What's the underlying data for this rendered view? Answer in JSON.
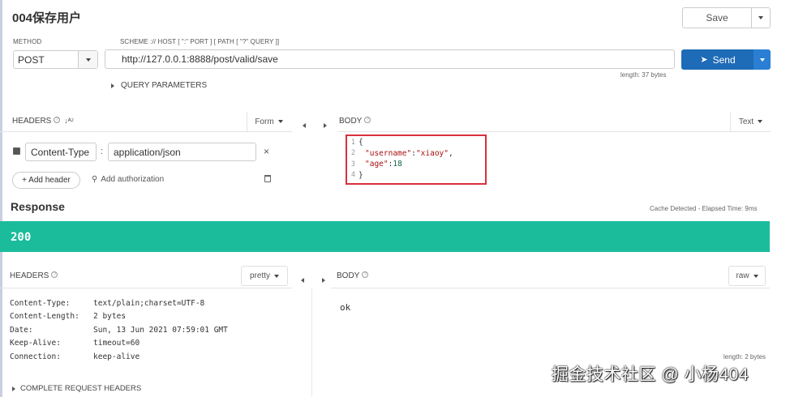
{
  "request": {
    "title": "004保存用户",
    "save_label": "Save",
    "method_label": "METHOD",
    "method": "POST",
    "url_hint": "SCHEME :// HOST [ \":\" PORT ] [ PATH [ \"?\" QUERY ]]",
    "url": "http://127.0.0.1:8888/post/valid/save",
    "send_label": "Send",
    "length": "length: 37 bytes",
    "query_params_label": "QUERY PARAMETERS"
  },
  "req_headers": {
    "label": "HEADERS",
    "mode": "Form",
    "rows": [
      {
        "name": "Content-Type",
        "value": "application/json"
      }
    ],
    "add_header": "+ Add header",
    "add_auth": "Add authorization"
  },
  "req_body": {
    "label": "BODY",
    "mode": "Text",
    "lines": [
      {
        "n": "1",
        "text": "{"
      },
      {
        "n": "2",
        "key": "\"username\"",
        "sep": ":",
        "val": "\"xiaoy\"",
        "end": ","
      },
      {
        "n": "3",
        "key": "\"age\"",
        "sep": ":",
        "num": "18",
        "end": ""
      },
      {
        "n": "4",
        "text": "}"
      }
    ]
  },
  "response": {
    "title": "Response",
    "cache_info": "Cache Detected - Elapsed Time: 9ms",
    "status": "200",
    "status_color": "#1abc9c",
    "headers_label": "HEADERS",
    "headers_mode": "pretty",
    "headers": [
      {
        "k": "Content-Type:",
        "v": "text/plain;charset=UTF-8"
      },
      {
        "k": "Content-Length:",
        "v": "2 bytes"
      },
      {
        "k": "Date:",
        "v": "Sun, 13 Jun 2021 07:59:01 GMT"
      },
      {
        "k": "Keep-Alive:",
        "v": "timeout=60"
      },
      {
        "k": "Connection:",
        "v": "keep-alive"
      }
    ],
    "complete_headers": "COMPLETE REQUEST HEADERS",
    "body_label": "BODY",
    "body_mode": "raw",
    "body": "ok",
    "length": "length: 2 bytes"
  },
  "watermark": "掘金技术社区 @ 小杨404"
}
